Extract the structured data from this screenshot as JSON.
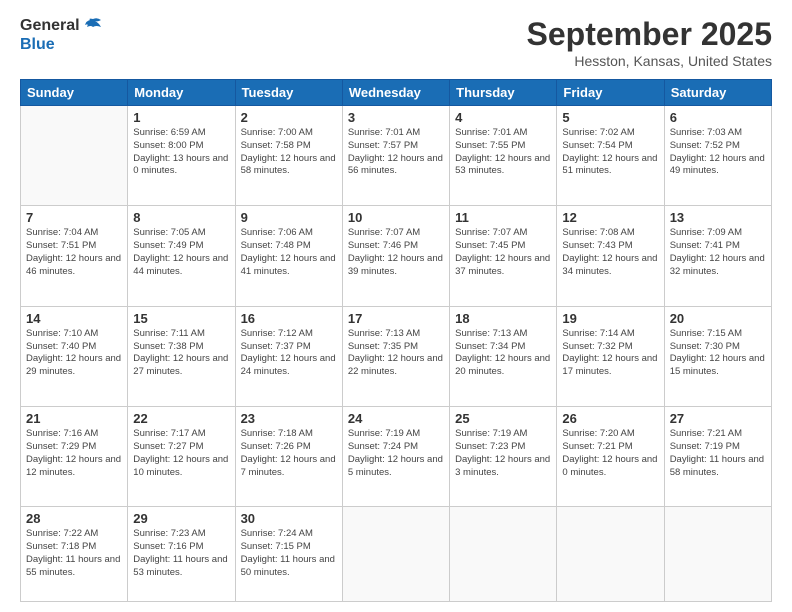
{
  "logo": {
    "line1": "General",
    "line2": "Blue"
  },
  "title": "September 2025",
  "subtitle": "Hesston, Kansas, United States",
  "weekdays": [
    "Sunday",
    "Monday",
    "Tuesday",
    "Wednesday",
    "Thursday",
    "Friday",
    "Saturday"
  ],
  "weeks": [
    [
      null,
      {
        "day": 1,
        "sunrise": "6:59 AM",
        "sunset": "8:00 PM",
        "daylight": "13 hours and 0 minutes"
      },
      {
        "day": 2,
        "sunrise": "7:00 AM",
        "sunset": "7:58 PM",
        "daylight": "12 hours and 58 minutes"
      },
      {
        "day": 3,
        "sunrise": "7:01 AM",
        "sunset": "7:57 PM",
        "daylight": "12 hours and 56 minutes"
      },
      {
        "day": 4,
        "sunrise": "7:01 AM",
        "sunset": "7:55 PM",
        "daylight": "12 hours and 53 minutes"
      },
      {
        "day": 5,
        "sunrise": "7:02 AM",
        "sunset": "7:54 PM",
        "daylight": "12 hours and 51 minutes"
      },
      {
        "day": 6,
        "sunrise": "7:03 AM",
        "sunset": "7:52 PM",
        "daylight": "12 hours and 49 minutes"
      }
    ],
    [
      {
        "day": 7,
        "sunrise": "7:04 AM",
        "sunset": "7:51 PM",
        "daylight": "12 hours and 46 minutes"
      },
      {
        "day": 8,
        "sunrise": "7:05 AM",
        "sunset": "7:49 PM",
        "daylight": "12 hours and 44 minutes"
      },
      {
        "day": 9,
        "sunrise": "7:06 AM",
        "sunset": "7:48 PM",
        "daylight": "12 hours and 41 minutes"
      },
      {
        "day": 10,
        "sunrise": "7:07 AM",
        "sunset": "7:46 PM",
        "daylight": "12 hours and 39 minutes"
      },
      {
        "day": 11,
        "sunrise": "7:07 AM",
        "sunset": "7:45 PM",
        "daylight": "12 hours and 37 minutes"
      },
      {
        "day": 12,
        "sunrise": "7:08 AM",
        "sunset": "7:43 PM",
        "daylight": "12 hours and 34 minutes"
      },
      {
        "day": 13,
        "sunrise": "7:09 AM",
        "sunset": "7:41 PM",
        "daylight": "12 hours and 32 minutes"
      }
    ],
    [
      {
        "day": 14,
        "sunrise": "7:10 AM",
        "sunset": "7:40 PM",
        "daylight": "12 hours and 29 minutes"
      },
      {
        "day": 15,
        "sunrise": "7:11 AM",
        "sunset": "7:38 PM",
        "daylight": "12 hours and 27 minutes"
      },
      {
        "day": 16,
        "sunrise": "7:12 AM",
        "sunset": "7:37 PM",
        "daylight": "12 hours and 24 minutes"
      },
      {
        "day": 17,
        "sunrise": "7:13 AM",
        "sunset": "7:35 PM",
        "daylight": "12 hours and 22 minutes"
      },
      {
        "day": 18,
        "sunrise": "7:13 AM",
        "sunset": "7:34 PM",
        "daylight": "12 hours and 20 minutes"
      },
      {
        "day": 19,
        "sunrise": "7:14 AM",
        "sunset": "7:32 PM",
        "daylight": "12 hours and 17 minutes"
      },
      {
        "day": 20,
        "sunrise": "7:15 AM",
        "sunset": "7:30 PM",
        "daylight": "12 hours and 15 minutes"
      }
    ],
    [
      {
        "day": 21,
        "sunrise": "7:16 AM",
        "sunset": "7:29 PM",
        "daylight": "12 hours and 12 minutes"
      },
      {
        "day": 22,
        "sunrise": "7:17 AM",
        "sunset": "7:27 PM",
        "daylight": "12 hours and 10 minutes"
      },
      {
        "day": 23,
        "sunrise": "7:18 AM",
        "sunset": "7:26 PM",
        "daylight": "12 hours and 7 minutes"
      },
      {
        "day": 24,
        "sunrise": "7:19 AM",
        "sunset": "7:24 PM",
        "daylight": "12 hours and 5 minutes"
      },
      {
        "day": 25,
        "sunrise": "7:19 AM",
        "sunset": "7:23 PM",
        "daylight": "12 hours and 3 minutes"
      },
      {
        "day": 26,
        "sunrise": "7:20 AM",
        "sunset": "7:21 PM",
        "daylight": "12 hours and 0 minutes"
      },
      {
        "day": 27,
        "sunrise": "7:21 AM",
        "sunset": "7:19 PM",
        "daylight": "11 hours and 58 minutes"
      }
    ],
    [
      {
        "day": 28,
        "sunrise": "7:22 AM",
        "sunset": "7:18 PM",
        "daylight": "11 hours and 55 minutes"
      },
      {
        "day": 29,
        "sunrise": "7:23 AM",
        "sunset": "7:16 PM",
        "daylight": "11 hours and 53 minutes"
      },
      {
        "day": 30,
        "sunrise": "7:24 AM",
        "sunset": "7:15 PM",
        "daylight": "11 hours and 50 minutes"
      },
      null,
      null,
      null,
      null
    ]
  ]
}
